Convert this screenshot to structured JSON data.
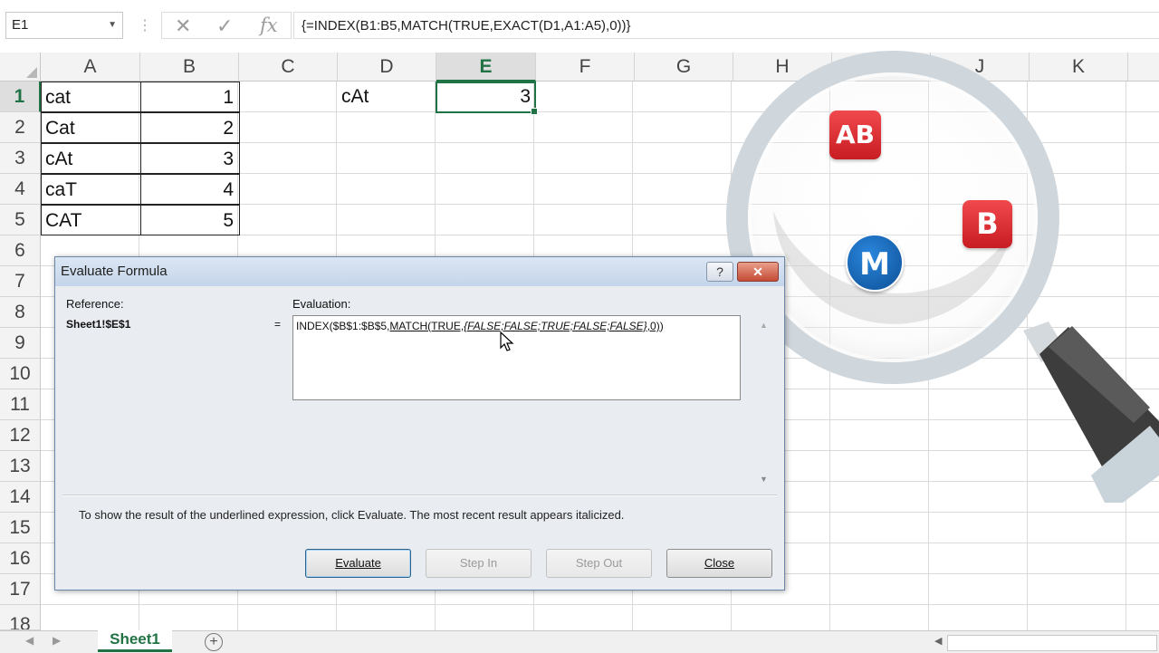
{
  "formula_bar": {
    "name_box": "E1",
    "cancel_glyph": "✕",
    "enter_glyph": "✓",
    "fx_glyph": "fx",
    "formula": "{=INDEX(B1:B5,MATCH(TRUE,EXACT(D1,A1:A5),0))}"
  },
  "columns": [
    "A",
    "B",
    "C",
    "D",
    "E",
    "F",
    "G",
    "H",
    "I",
    "J",
    "K"
  ],
  "selected_column": "E",
  "rows": [
    "1",
    "2",
    "3",
    "4",
    "5",
    "6",
    "7",
    "8",
    "9",
    "10",
    "11",
    "12",
    "13",
    "14",
    "15",
    "16",
    "17",
    "18"
  ],
  "selected_row": "1",
  "cells": {
    "a": [
      "cat",
      "Cat",
      "cAt",
      "caT",
      "CAT"
    ],
    "b": [
      "1",
      "2",
      "3",
      "4",
      "5"
    ],
    "d1": "cAt",
    "e1": "3"
  },
  "sheet_tab": "Sheet1",
  "add_sheet": "+",
  "dialog": {
    "title": "Evaluate Formula",
    "help": "?",
    "close_x": "✕",
    "reference_label": "Reference:",
    "reference_value": "Sheet1!$E$1",
    "equals": "=",
    "evaluation_label": "Evaluation:",
    "eval_part1": "INDEX($B$1:$B$5,",
    "eval_part2": "MATCH(TRUE,",
    "eval_part3": "{FALSE;FALSE;TRUE;FALSE;FALSE}",
    "eval_part4": ",0)",
    "eval_part5": ")",
    "hint": "To show the result of the underlined expression, click Evaluate.  The most recent result appears italicized.",
    "buttons": {
      "evaluate": "Evaluate",
      "step_in": "Step In",
      "step_out": "Step Out",
      "close": "Close"
    }
  },
  "overlay": {
    "badge_ab": "AB",
    "badge_b": "B",
    "badge_m": "M",
    "colors": {
      "red": "#e0262b",
      "blue": "#1565b8"
    }
  }
}
